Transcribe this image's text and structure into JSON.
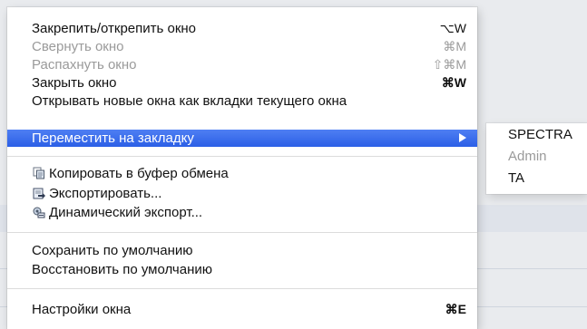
{
  "menu": {
    "items": [
      {
        "label": "Закрепить/открепить окно",
        "shortcut": "⌥W"
      },
      {
        "label": "Свернуть окно",
        "shortcut": "⌘M",
        "disabled": true
      },
      {
        "label": "Распахнуть окно",
        "shortcut": "⇧⌘M",
        "disabled": true
      },
      {
        "label": "Закрыть окно",
        "shortcut": "⌘W"
      },
      {
        "label": "Открывать новые окна как вкладки текущего окна"
      },
      {
        "label": "Переместить на закладку",
        "highlighted": true,
        "submenu": true
      },
      {
        "label": "Копировать в буфер обмена",
        "icon": "clipboard-copy-icon"
      },
      {
        "label": "Экспортировать...",
        "icon": "export-icon"
      },
      {
        "label": "Динамический экспорт...",
        "icon": "dynamic-export-icon"
      },
      {
        "label": "Сохранить по умолчанию"
      },
      {
        "label": "Восстановить по умолчанию"
      },
      {
        "label": "Настройки окна",
        "shortcut": "⌘E"
      }
    ],
    "highlight_color": "#3a6cec"
  },
  "submenu": {
    "items": [
      {
        "label": "SPECTRA"
      },
      {
        "label": "Admin",
        "disabled": true
      },
      {
        "label": "TA"
      }
    ]
  }
}
